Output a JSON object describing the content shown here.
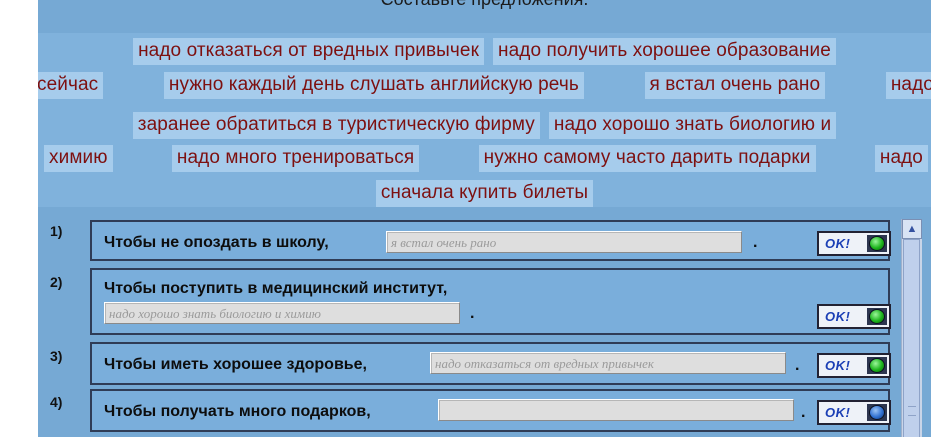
{
  "page": {
    "title": "Составьте предложения."
  },
  "word_bank": {
    "line1": [
      "надо отказаться от вредных привычек",
      "надо получить хорошее образование"
    ],
    "line2": [
      "сейчас",
      "нужно каждый день слушать английскую речь",
      "я встал очень рано",
      "надо"
    ],
    "line3": [
      "заранее обратиться в туристическую фирму",
      "надо хорошо знать биологию и"
    ],
    "line4": [
      "химию",
      "надо много тренироваться",
      "нужно самому часто дарить подарки",
      "надо"
    ],
    "line5": [
      "сначала купить билеты"
    ]
  },
  "questions": [
    {
      "number": "1)",
      "text": "Чтобы не опоздать в школу,",
      "answer": "я встал очень рано",
      "end": ".",
      "ok_label": "OK!",
      "status": "green"
    },
    {
      "number": "2)",
      "text": "Чтобы поступить в медицинский институт,",
      "answer": "надо хорошо знать биологию и химию",
      "end": ".",
      "ok_label": "OK!",
      "status": "green"
    },
    {
      "number": "3)",
      "text": "Чтобы иметь хорошее здоровье,",
      "answer": "надо отказаться от вредных привычек",
      "end": ".",
      "ok_label": "OK!",
      "status": "green"
    },
    {
      "number": "4)",
      "text": "Чтобы получать много подарков,",
      "answer": "",
      "end": ".",
      "ok_label": "OK!",
      "status": "blue"
    }
  ],
  "colors": {
    "background": "#76a9d4",
    "chip": "#a6ccec",
    "chip_text": "#7d1010",
    "led_green": "#1bb31b",
    "led_blue": "#2f6fd0"
  },
  "icons": {
    "scroll_up": "chevron-up-icon",
    "status_led": "status-light-icon"
  }
}
